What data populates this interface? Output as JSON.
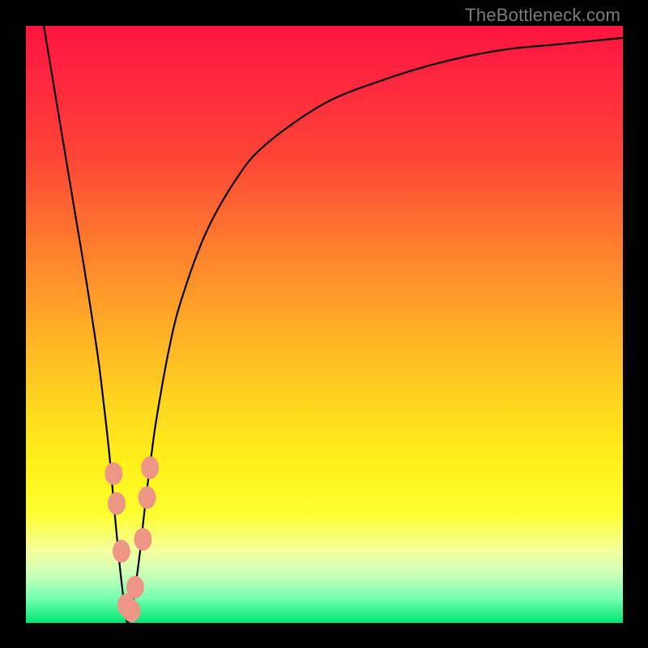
{
  "attribution": "TheBottleneck.com",
  "chart_data": {
    "type": "line",
    "title": "",
    "xlabel": "",
    "ylabel": "",
    "xlim": [
      0,
      100
    ],
    "ylim": [
      0,
      100
    ],
    "x": [
      3,
      5,
      8,
      10,
      12,
      13,
      14,
      15,
      16,
      17,
      18,
      19,
      20,
      21,
      22,
      24,
      26,
      30,
      35,
      40,
      50,
      60,
      70,
      80,
      90,
      100
    ],
    "values": [
      100,
      88,
      70,
      58,
      45,
      37,
      28,
      17,
      7,
      0,
      4,
      11,
      20,
      28,
      35,
      46,
      54,
      65,
      74,
      80,
      87,
      91,
      94,
      96,
      97,
      98
    ],
    "minimum_x": 17,
    "markers": [
      {
        "x": 14.7,
        "y": 25
      },
      {
        "x": 15.2,
        "y": 20
      },
      {
        "x": 16.0,
        "y": 12
      },
      {
        "x": 16.8,
        "y": 3
      },
      {
        "x": 17.7,
        "y": 2
      },
      {
        "x": 18.3,
        "y": 6
      },
      {
        "x": 19.6,
        "y": 14
      },
      {
        "x": 20.3,
        "y": 21
      },
      {
        "x": 20.8,
        "y": 26
      }
    ],
    "marker_color": "#ed9686",
    "curve_color": "#000000",
    "background": "gradient-red-yellow-green"
  }
}
